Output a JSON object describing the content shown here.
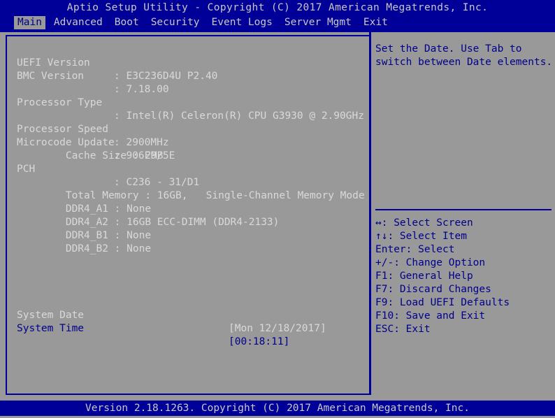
{
  "title_bar": {
    "text": "Aptio Setup Utility - Copyright (C) 2017 American Megatrends, Inc."
  },
  "menu_bar": {
    "items": [
      {
        "label": "Main",
        "active": true
      },
      {
        "label": "Advanced",
        "active": false
      },
      {
        "label": "Boot",
        "active": false
      },
      {
        "label": "Security",
        "active": false
      },
      {
        "label": "Event Logs",
        "active": false
      },
      {
        "label": "Server Mgmt",
        "active": false
      },
      {
        "label": "Exit",
        "active": false
      }
    ]
  },
  "main_panel": {
    "info_rows": [
      {
        "label": "UEFI Version",
        "separator": ":",
        "value": "E3C236D4U P2.40"
      },
      {
        "label": "BMC Version",
        "separator": ":",
        "value": "7.18.00"
      },
      {
        "label": "Processor Type",
        "separator": ":",
        "value": "Intel(R) Celeron(R) CPU G3930 @ 2.90GHz"
      },
      {
        "label": "Processor Speed",
        "separator": ":",
        "value": "2900MHz"
      },
      {
        "label": "Microcode Update",
        "separator": ":",
        "value": "906E9/5E"
      },
      {
        "label": "Cache Size",
        "separator": ":",
        "value": "2MB"
      },
      {
        "label": "PCH",
        "separator": ":",
        "value": "C236 - 31/D1"
      }
    ],
    "cache_size_inline": "Cache Size : 2MB",
    "memory": {
      "total_line": "Total Memory : 16GB,   Single-Channel Memory Mode",
      "slots": [
        "DDR4_A1 : None",
        "DDR4_A2 : 16GB ECC-DIMM (DDR4-2133)",
        "DDR4_B1 : None",
        "DDR4_B2 : None"
      ]
    },
    "settings": [
      {
        "label": "System Date",
        "value": "[Mon 12/18/2017]",
        "selected": false
      },
      {
        "label": "System Time",
        "value": "[00:18:11]",
        "selected": true
      }
    ]
  },
  "help_panel": {
    "help_lines": [
      "Set the Date. Use Tab to",
      "switch between Date elements."
    ],
    "legend": [
      "↔: Select Screen",
      "↑↓: Select Item",
      "Enter: Select",
      "+/-: Change Option",
      "F1: General Help",
      "F7: Discard Changes",
      "F9: Load UEFI Defaults",
      "F10: Save and Exit",
      "ESC: Exit"
    ]
  },
  "footer": {
    "text": "Version 2.18.1263. Copyright (C) 2017 American Megatrends, Inc."
  },
  "colors": {
    "background": "#999999",
    "bar_blue": "#000099",
    "text_light": "#d9d9d9",
    "text_blue": "#00008c",
    "bar_text": "#c8c8c8"
  }
}
